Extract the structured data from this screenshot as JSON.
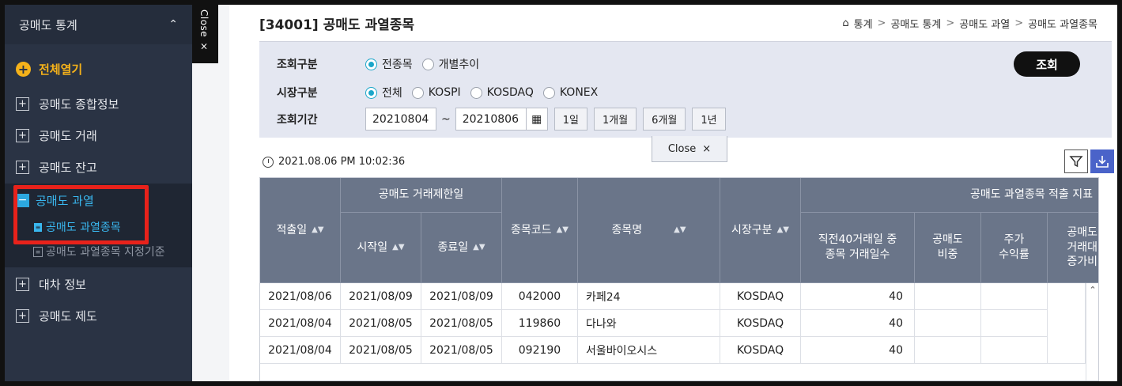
{
  "sidebar": {
    "header": "공매도 통계",
    "expand_all": "전체열기",
    "items": [
      {
        "label": "공매도 종합정보"
      },
      {
        "label": "공매도 거래"
      },
      {
        "label": "공매도 잔고"
      },
      {
        "label": "공매도 과열"
      },
      {
        "label": "대차 정보"
      },
      {
        "label": "공매도 제도"
      }
    ],
    "sub_items": [
      {
        "label": "공매도 과열종목"
      },
      {
        "label": "공매도 과열종목 지정기준"
      }
    ]
  },
  "close_tab": "Close ×",
  "page": {
    "title": "[34001] 공매도 과열종목",
    "breadcrumb": [
      "통계",
      "공매도 통계",
      "공매도 과열",
      "공매도 과열종목"
    ]
  },
  "search": {
    "query_type_label": "조회구분",
    "query_type_options": [
      "전종목",
      "개별추이"
    ],
    "market_label": "시장구분",
    "market_options": [
      "전체",
      "KOSPI",
      "KOSDAQ",
      "KONEX"
    ],
    "period_label": "조회기간",
    "start_date": "20210804",
    "tilde": "~",
    "end_date": "20210806",
    "period_buttons": [
      "1일",
      "1개월",
      "6개월",
      "1년"
    ],
    "search_button": "조회",
    "close_label": "Close"
  },
  "timestamp": "2021.08.06 PM 10:02:36",
  "table": {
    "headers": {
      "date": "적출일",
      "restrict_group": "공매도 거래제한일",
      "start": "시작일",
      "end": "종료일",
      "code": "종목코드",
      "name": "종목명",
      "market": "시장구분",
      "indicator_group": "공매도 과열종목 적출 지표",
      "days_line1": "직전40거래일 중",
      "days_line2": "종목 거래일수",
      "ratio_line1": "공매도",
      "ratio_line2": "비중",
      "return_line1": "주가",
      "return_line2": "수익률",
      "incr_line1": "공매도",
      "incr_line2": "거래대",
      "incr_line3": "증가비"
    },
    "rows": [
      {
        "date": "2021/08/06",
        "start": "2021/08/09",
        "end": "2021/08/09",
        "code": "042000",
        "name": "카페24",
        "market": "KOSDAQ",
        "days": "40"
      },
      {
        "date": "2021/08/04",
        "start": "2021/08/05",
        "end": "2021/08/05",
        "code": "119860",
        "name": "다나와",
        "market": "KOSDAQ",
        "days": "40"
      },
      {
        "date": "2021/08/04",
        "start": "2021/08/05",
        "end": "2021/08/05",
        "code": "092190",
        "name": "서울바이오시스",
        "market": "KOSDAQ",
        "days": "40"
      }
    ]
  },
  "colors": {
    "sidebar_bg": "#2a3344",
    "accent_blue": "#39b7ef",
    "accent_orange": "#f5b21a",
    "highlight_red": "#e8221b",
    "header_bg": "#6a7589",
    "panel_bg": "#e4e7f1"
  }
}
